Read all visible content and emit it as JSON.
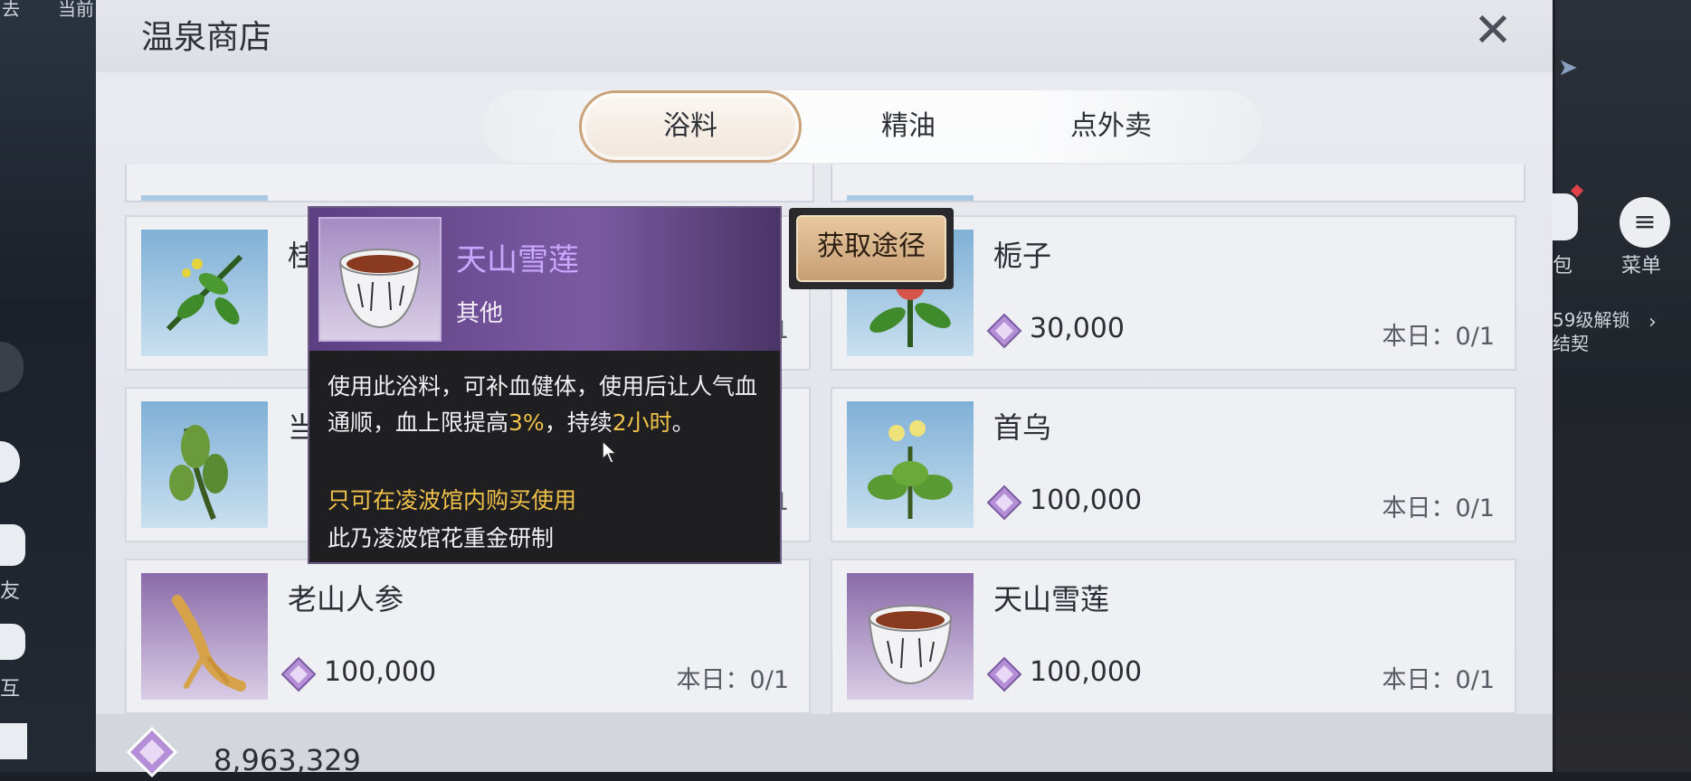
{
  "background": {
    "left_fragments": [
      "去",
      "当前"
    ],
    "left_labels": [
      "友",
      "互"
    ],
    "right_labels": [
      "包",
      "菜单"
    ],
    "unlock_text": [
      "59级解锁",
      "结契"
    ]
  },
  "shop": {
    "title": "温泉商店",
    "tabs": [
      {
        "label": "浴料",
        "active": true
      },
      {
        "label": "精油",
        "active": false
      },
      {
        "label": "点外卖",
        "active": false
      }
    ],
    "items": [
      {
        "name": "桂",
        "price": "",
        "limit": "1",
        "thumb": "blue",
        "icon": "herb-sprig-icon"
      },
      {
        "name": "栀子",
        "price": "30,000",
        "limit": "本日：0/1",
        "thumb": "blue",
        "icon": "gardenia-flower-icon"
      },
      {
        "name": "当",
        "price": "",
        "limit": "1",
        "thumb": "blue",
        "icon": "fern-herb-icon"
      },
      {
        "name": "首乌",
        "price": "100,000",
        "limit": "本日：0/1",
        "thumb": "blue",
        "icon": "flowering-plant-icon"
      },
      {
        "name": "老山人参",
        "price": "100,000",
        "limit": "本日：0/1",
        "thumb": "purple",
        "icon": "ginseng-root-icon"
      },
      {
        "name": "天山雪莲",
        "price": "100,000",
        "limit": "本日：0/1",
        "thumb": "purple",
        "icon": "tea-bowl-icon"
      }
    ],
    "currency_total": "8,963,329"
  },
  "tooltip": {
    "name": "天山雪莲",
    "type": "其他",
    "desc_part1": "使用此浴料，可补血健体，使用后让人气血通顺，血上限提高",
    "desc_hl1": "3%",
    "desc_part2": "，持续",
    "desc_hl2": "2小时",
    "desc_part3": "。",
    "note": "只可在凌波馆内购买使用",
    "credit": "此乃凌波馆花重金研制",
    "source_button": "获取途径"
  },
  "colors": {
    "accent_gold": "#f0c24a",
    "rare_purple": "#c9a7ff",
    "tab_border": "#c9a27a"
  }
}
